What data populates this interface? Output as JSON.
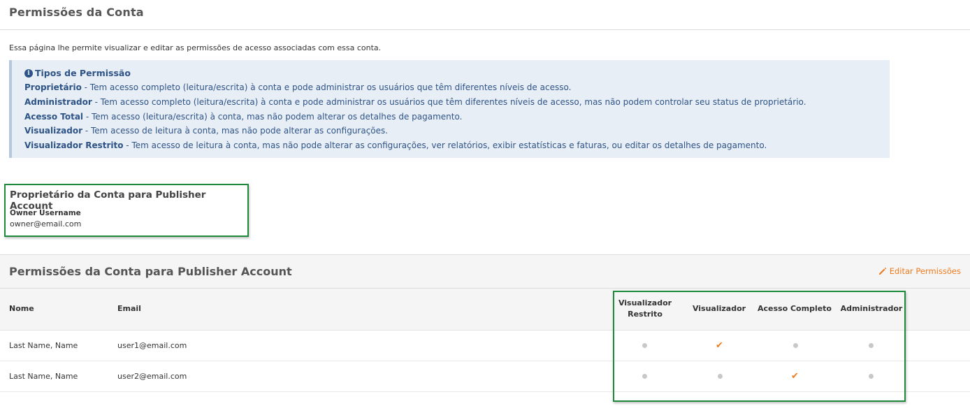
{
  "page": {
    "title": "Permissões da Conta"
  },
  "intro": "Essa página lhe permite visualizar e editar as permissões de acesso associadas com essa conta.",
  "info": {
    "title": "Tipos de Permissão",
    "icon": "info-circle-icon",
    "items": [
      {
        "name": "Proprietário",
        "desc": " - Tem acesso completo (leitura/escrita) à conta e pode administrar os usuários que têm diferentes níveis de acesso."
      },
      {
        "name": "Administrador",
        "desc": " - Tem acesso completo (leitura/escrita) à conta e pode administrar os usuários que têm diferentes níveis de acesso, mas não podem controlar seu status de proprietário."
      },
      {
        "name": "Acesso Total",
        "desc": " - Tem acesso (leitura/escrita) à conta, mas não podem alterar os detalhes de pagamento."
      },
      {
        "name": "Visualizador",
        "desc": " - Tem acesso de leitura à conta, mas não pode alterar as configurações."
      },
      {
        "name": "Visualizador Restrito",
        "desc": " - Tem acesso de leitura à conta, mas não pode alterar as configurações, ver relatórios, exibir estatísticas e faturas, ou editar os detalhes de pagamento."
      }
    ]
  },
  "owner": {
    "title": "Proprietário da Conta para Publisher Account",
    "label": "Owner Username",
    "value": "owner@email.com"
  },
  "permissions": {
    "title": "Permissões da Conta para Publisher Account",
    "edit_label": "Editar Permissões",
    "edit_icon": "pencil-icon",
    "columns": {
      "name": "Nome",
      "email": "Email",
      "restricted": "Visualizador Restrito",
      "viewer": "Visualizador",
      "full": "Acesso Completo",
      "admin": "Administrador"
    },
    "rows": [
      {
        "name": "Last Name, Name",
        "email": "user1@email.com",
        "level": "viewer"
      },
      {
        "name": "Last Name, Name",
        "email": "user2@email.com",
        "level": "full"
      }
    ],
    "check_glyph": "✔",
    "colors": {
      "accent": "#f07b1d",
      "dot": "#c8c8c8",
      "highlight": "#1e8a3c",
      "info_text": "#2e5487"
    }
  }
}
